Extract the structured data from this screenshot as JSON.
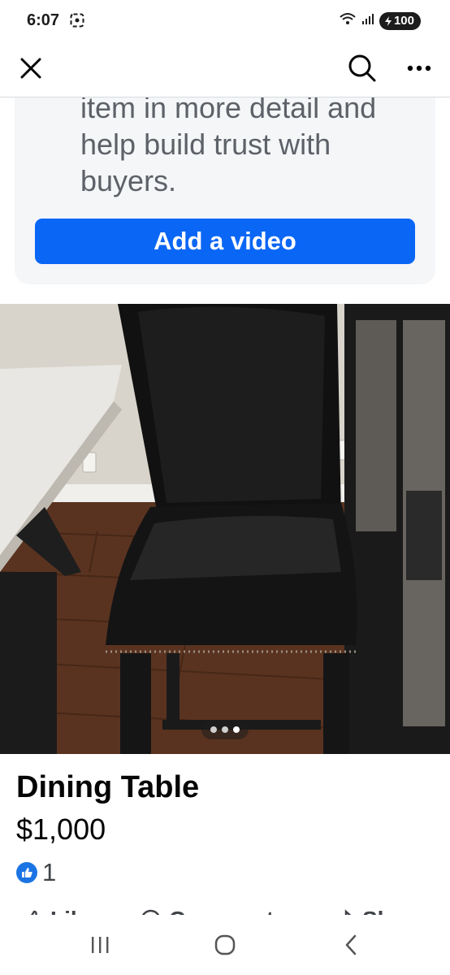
{
  "status_bar": {
    "time": "6:07",
    "battery": "100"
  },
  "top_bar": {
    "close_icon": "close-icon",
    "search_icon": "search-icon",
    "more_icon": "more-horizontal-icon"
  },
  "video_card": {
    "text": "item in more detail and help build trust with buyers.",
    "button_label": "Add a video"
  },
  "photo": {
    "carousel": {
      "total": 3,
      "active": 3
    }
  },
  "listing": {
    "title": "Dining Table",
    "price": "$1,000",
    "reaction_count": "1"
  },
  "actions": {
    "like": "Like",
    "comment": "Comment",
    "share": "Share"
  },
  "colors": {
    "accent": "#0a66f5",
    "like": "#1b74e4",
    "card_bg": "#f5f6f8"
  }
}
